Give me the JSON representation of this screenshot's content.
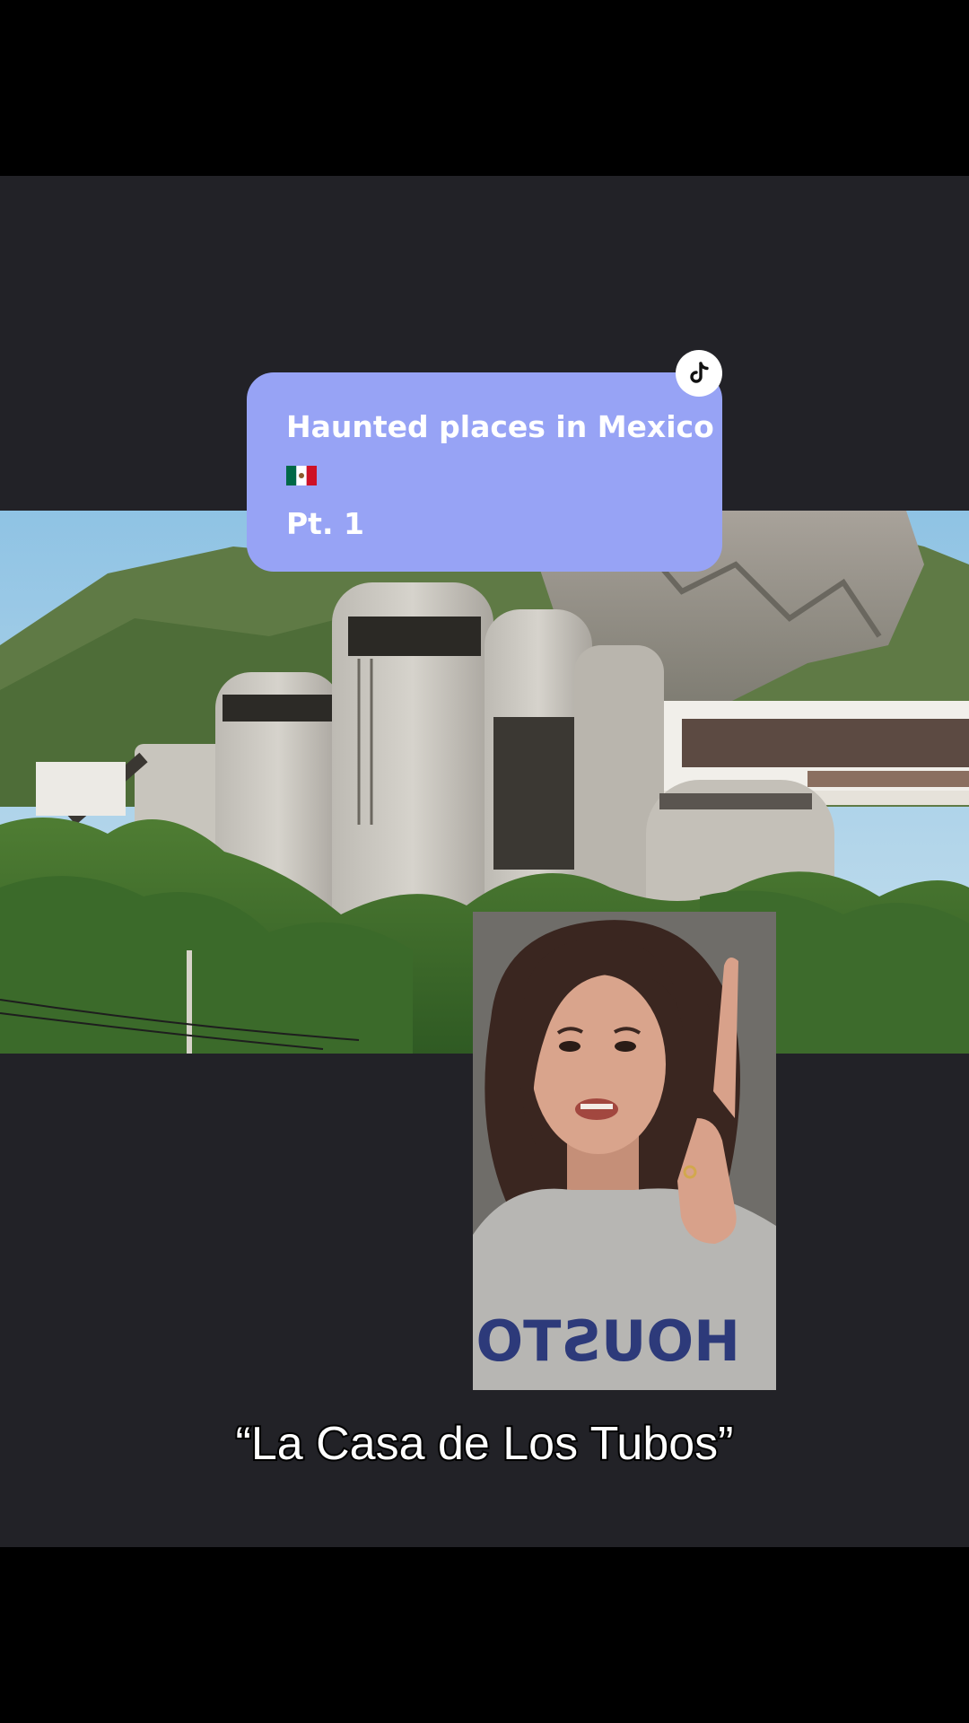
{
  "card": {
    "title": "Haunted places in Mexico",
    "flag_emoji": "🇲🇽",
    "part": "Pt. 1",
    "background": "#97a3f5"
  },
  "badge": {
    "icon": "tiktok-logo-icon"
  },
  "subtitle": {
    "text": "“La Casa de Los Tubos”"
  },
  "photo": {
    "subject": "concrete-tube-building-icon"
  },
  "presenter": {
    "shirt_text": "HOUSTON"
  },
  "colors": {
    "background": "#000000",
    "video_panel": "#222227",
    "card": "#97a3f5",
    "text": "#ffffff"
  }
}
